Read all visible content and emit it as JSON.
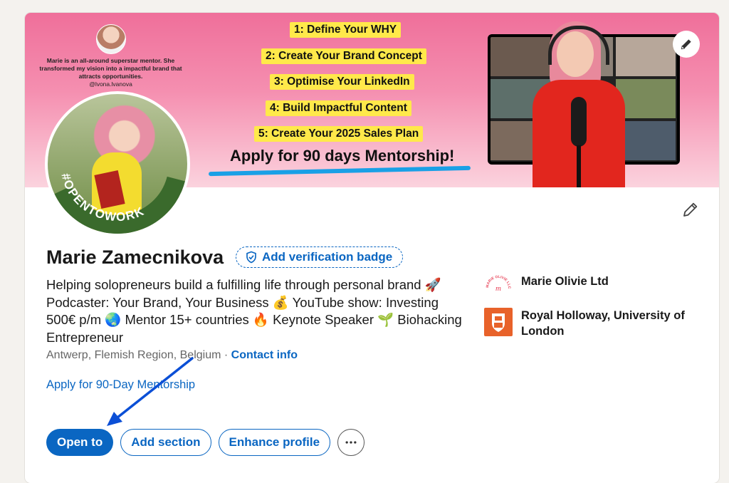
{
  "banner": {
    "testimonial_text": "Marie is an all-around superstar mentor. She transformed my vision into a impactful brand that attracts opportunities.",
    "testimonial_handle": "@lvona.lvanova",
    "steps": [
      "1: Define Your WHY",
      "2: Create Your Brand Concept",
      "3: Optimise Your LinkedIn",
      "4: Build Impactful Content",
      "5: Create Your 2025 Sales Plan"
    ],
    "cta": "Apply for 90 days Mentorship!",
    "edit_icon": "pencil-icon"
  },
  "profile": {
    "open_to_work_badge": "#OPENTOWORK",
    "name": "Marie Zamecnikova",
    "verification_label": "Add verification badge",
    "headline": "Helping solopreneurs build a fulfilling life through personal brand 🚀 Podcaster: Your Brand, Your Business 💰 YouTube show: Investing 500€ p/m 🌏 Mentor 15+ countries 🔥 Keynote Speaker 🌱 Biohacking Entrepreneur",
    "location": "Antwerp, Flemish Region, Belgium",
    "separator": "·",
    "contact_info": "Contact info",
    "website_link": "Apply for 90-Day Mentorship"
  },
  "organizations": [
    {
      "name": "Marie Olivie Ltd",
      "logo_text": "MARIE OLIVIE LLC",
      "logo_color": "#e8445a"
    },
    {
      "name": "Royal Holloway, University of London",
      "logo_color": "#e8622a"
    }
  ],
  "actions": {
    "open_to": "Open to",
    "add_section": "Add section",
    "enhance_profile": "Enhance profile",
    "more_icon": "more-horizontal-icon"
  },
  "colors": {
    "accent": "#0a66c2",
    "open_to_work_green": "#3a6a2c",
    "annotation_arrow": "#0b4fd6"
  }
}
